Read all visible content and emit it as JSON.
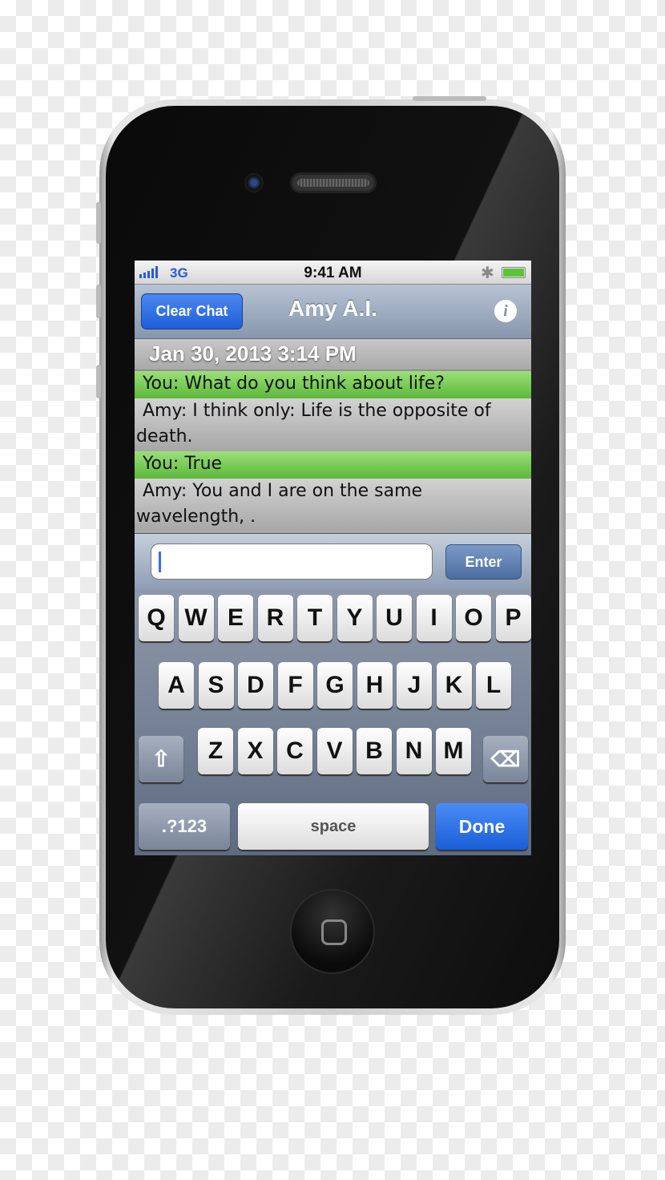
{
  "status_bar": {
    "network": "3G",
    "time": "9:41 AM",
    "signal_bars": 5,
    "bluetooth_icon": "bluetooth-icon",
    "battery_level": 100,
    "battery_color": "#5cc43a"
  },
  "nav": {
    "left_button": "Clear Chat",
    "title": "Amy A.I.",
    "info_icon": "info-icon"
  },
  "chat": {
    "date_header": "Jan 30, 2013 3:14 PM",
    "messages": [
      {
        "sender": "you",
        "text": "You: What do you think about life?"
      },
      {
        "sender": "amy",
        "text": "Amy: I think only: Life is the opposite of death."
      },
      {
        "sender": "you",
        "text": "You: True"
      },
      {
        "sender": "amy",
        "text": "Amy:  You and I are on the same wavelength, ."
      }
    ]
  },
  "input": {
    "value": "",
    "enter_label": "Enter"
  },
  "keyboard": {
    "rows": [
      [
        "Q",
        "W",
        "E",
        "R",
        "T",
        "Y",
        "U",
        "I",
        "O",
        "P"
      ],
      [
        "A",
        "S",
        "D",
        "F",
        "G",
        "H",
        "J",
        "K",
        "L"
      ],
      [
        "Z",
        "X",
        "C",
        "V",
        "B",
        "N",
        "M"
      ]
    ],
    "shift_icon": "shift-icon",
    "delete_icon": "backspace-icon",
    "numbers_label": ".?123",
    "space_label": "space",
    "done_label": "Done"
  },
  "colors": {
    "you_bubble": "#6cc24a",
    "amy_bubble": "#b8b8b8",
    "accent": "#1e5fd8"
  }
}
